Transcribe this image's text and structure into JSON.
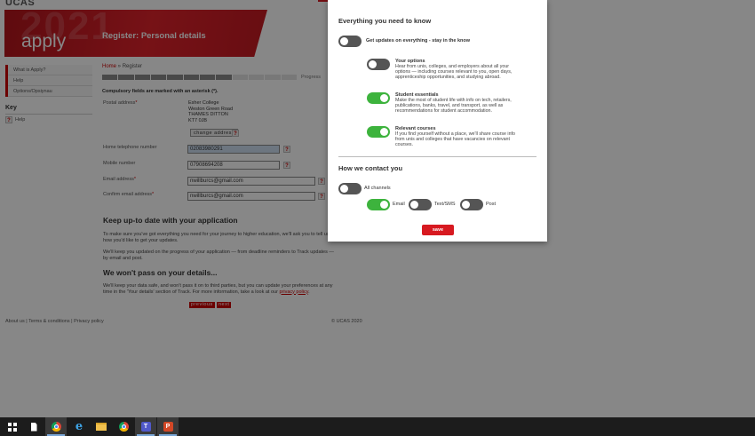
{
  "page": {
    "logo": "UCAS",
    "banner": {
      "year": "2021",
      "apply": "apply",
      "title": "Register: Personal details"
    },
    "left_nav": [
      "What is Apply?",
      "Help",
      "Options/Opsiynau"
    ],
    "key": {
      "title": "Key",
      "help_label": "Help",
      "help_glyph": "?"
    },
    "breadcrumb": {
      "home": "Home",
      "separator": " » ",
      "current": "Register"
    },
    "progress": {
      "label": "Progress",
      "total_steps": 12,
      "completed_steps": 8,
      "colors": {
        "done": "#8a8a8a",
        "todo": "#e3e3e3"
      }
    },
    "compulsory_note": "Compulsory fields are marked with an asterisk (*).",
    "form": {
      "postal_label": "Postal address",
      "postal_lines": [
        "Esher College",
        "Weston Green Road",
        "THAMES DITTON",
        "KT7 0JB"
      ],
      "change_address": "change address",
      "home_tel_label": "Home telephone number",
      "home_tel_value": "02083980291",
      "mobile_label": "Mobile number",
      "mobile_value": "07908694208",
      "email_label": "Email address",
      "email_value": "nwillburcs@gmail.com",
      "confirm_email_label": "Confirm email address",
      "confirm_email_value": "nwillburcs@gmail.com",
      "required_mark": "*",
      "help_glyph": "?"
    },
    "keep_up": {
      "heading": "Keep up-to date with your application",
      "para1": "To make sure you've got everything you need for your journey to higher education, we'll ask you to tell us how you'd like to get your updates.",
      "para2": "We'll keep you updated on the progress of your application — from deadline reminders to Track updates — by email and post."
    },
    "wont_pass": {
      "heading": "We won't pass on your details...",
      "para_start": "We'll keep your data safe, and won't pass it on to third parties, but you can update your preferences at any time in the 'Your details' section of Track. For more information, take a look at our ",
      "policy_link": "privacy policy",
      "para_end": "."
    },
    "buttons": {
      "previous": "previous",
      "next": "next"
    },
    "footer": {
      "about": "About us",
      "terms": "Terms & conditions",
      "privacy": "Privacy policy",
      "separator": " | ",
      "copyright": "© UCAS 2020"
    }
  },
  "modal": {
    "title": "Everything you need to know",
    "get_updates_label": "Get updates on everything - stay in the know",
    "get_updates_on": false,
    "options": [
      {
        "title": "Your options",
        "desc": "Hear from unis, colleges, and employers about all your options — including courses relevant to you, open days, apprenticeship opportunities, and studying abroad.",
        "on": false
      },
      {
        "title": "Student essentials",
        "desc": "Make the most of student life with info on tech, retailers, publications, banks, travel, and transport, as well as recommendations for student accommodation.",
        "on": true
      },
      {
        "title": "Relevant courses",
        "desc": "If you find yourself without a place, we'll share course info from unis and colleges that have vacancies on relevant courses.",
        "on": true
      }
    ],
    "contact_title": "How we contact you",
    "all_channels_label": "All channels",
    "all_channels_on": false,
    "channels": [
      {
        "label": "Email",
        "on": true
      },
      {
        "label": "Text/SMS",
        "on": false
      },
      {
        "label": "Post",
        "on": false
      }
    ],
    "save_label": "save",
    "colors": {
      "toggle_on": "#3db33d",
      "toggle_off": "#555555",
      "save": "#d71920"
    }
  },
  "taskbar": {
    "items": [
      {
        "name": "start-button",
        "icon": "windows-logo-icon"
      },
      {
        "name": "file-app",
        "icon": "file-icon"
      },
      {
        "name": "chrome-active",
        "icon": "chrome-icon",
        "active": true
      },
      {
        "name": "edge-ie",
        "icon": "internet-explorer-icon",
        "glyph": "e"
      },
      {
        "name": "file-explorer",
        "icon": "folder-icon"
      },
      {
        "name": "chrome",
        "icon": "chrome-icon"
      },
      {
        "name": "teams",
        "icon": "teams-icon",
        "glyph": "T"
      },
      {
        "name": "powerpoint",
        "icon": "powerpoint-icon",
        "glyph": "P"
      }
    ]
  }
}
